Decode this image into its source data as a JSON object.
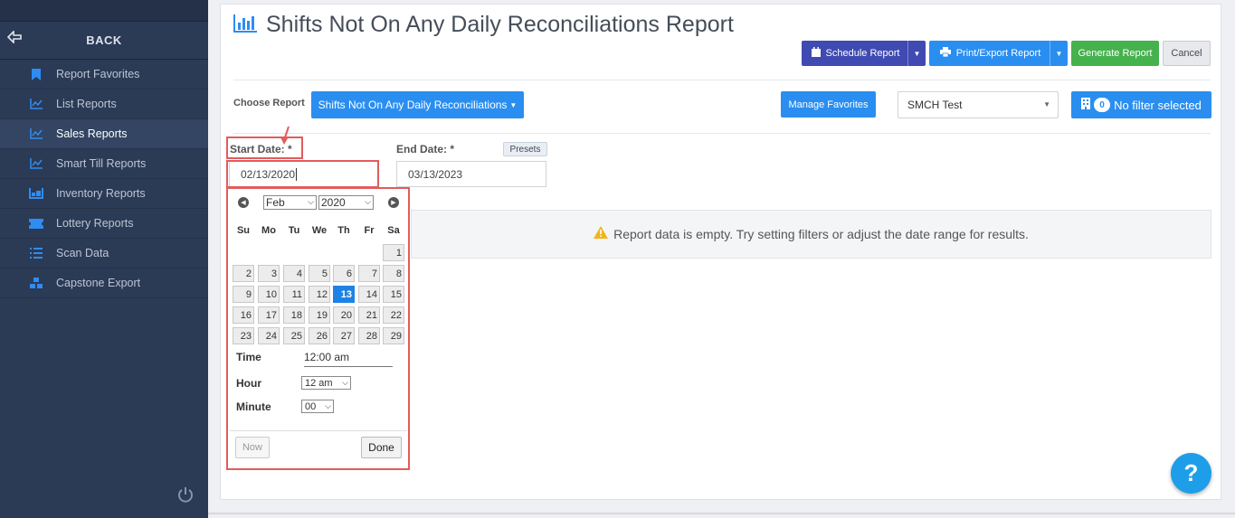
{
  "sidebar": {
    "back_label": "BACK",
    "items": [
      {
        "label": "Report Favorites",
        "icon": "bookmark-icon"
      },
      {
        "label": "List Reports",
        "icon": "line-chart-icon"
      },
      {
        "label": "Sales Reports",
        "icon": "line-chart-icon",
        "active": true
      },
      {
        "label": "Smart Till Reports",
        "icon": "line-chart-icon"
      },
      {
        "label": "Inventory Reports",
        "icon": "inventory-icon"
      },
      {
        "label": "Lottery Reports",
        "icon": "ticket-icon"
      },
      {
        "label": "Scan Data",
        "icon": "list-icon"
      },
      {
        "label": "Capstone Export",
        "icon": "cubes-icon"
      }
    ]
  },
  "header": {
    "title": "Shifts Not On Any Daily Reconciliations Report",
    "schedule_label": "Schedule Report",
    "print_label": "Print/Export Report",
    "generate_label": "Generate Report",
    "cancel_label": "Cancel"
  },
  "filters": {
    "choose_label": "Choose Report",
    "report_selected": "Shifts Not On Any Daily Reconciliations",
    "manage_label": "Manage Favorites",
    "store_selected": "SMCH Test",
    "filter_count": "0",
    "filter_label": "No filter selected",
    "start_label": "Start Date:",
    "end_label": "End Date:",
    "required_mark": "*",
    "start_value": "02/13/2020",
    "end_value": "03/13/2023",
    "presets_label": "Presets"
  },
  "empty_message": "Report data is empty. Try setting filters or adjust the date range for results.",
  "datepicker": {
    "month": "Feb",
    "year": "2020",
    "weekdays": [
      "Su",
      "Mo",
      "Tu",
      "We",
      "Th",
      "Fr",
      "Sa"
    ],
    "selected_day": 13,
    "time_label": "Time",
    "time_value": "12:00 am",
    "hour_label": "Hour",
    "hour_value": "12 am",
    "minute_label": "Minute",
    "minute_value": "00",
    "now_label": "Now",
    "done_label": "Done"
  },
  "help_label": "?",
  "colors": {
    "sidebar_bg": "#2b3a55",
    "accent_blue": "#2a8ef0",
    "schedule_purple": "#3f4ab2",
    "generate_green": "#45b24d",
    "highlight_red": "#e25c5c"
  }
}
